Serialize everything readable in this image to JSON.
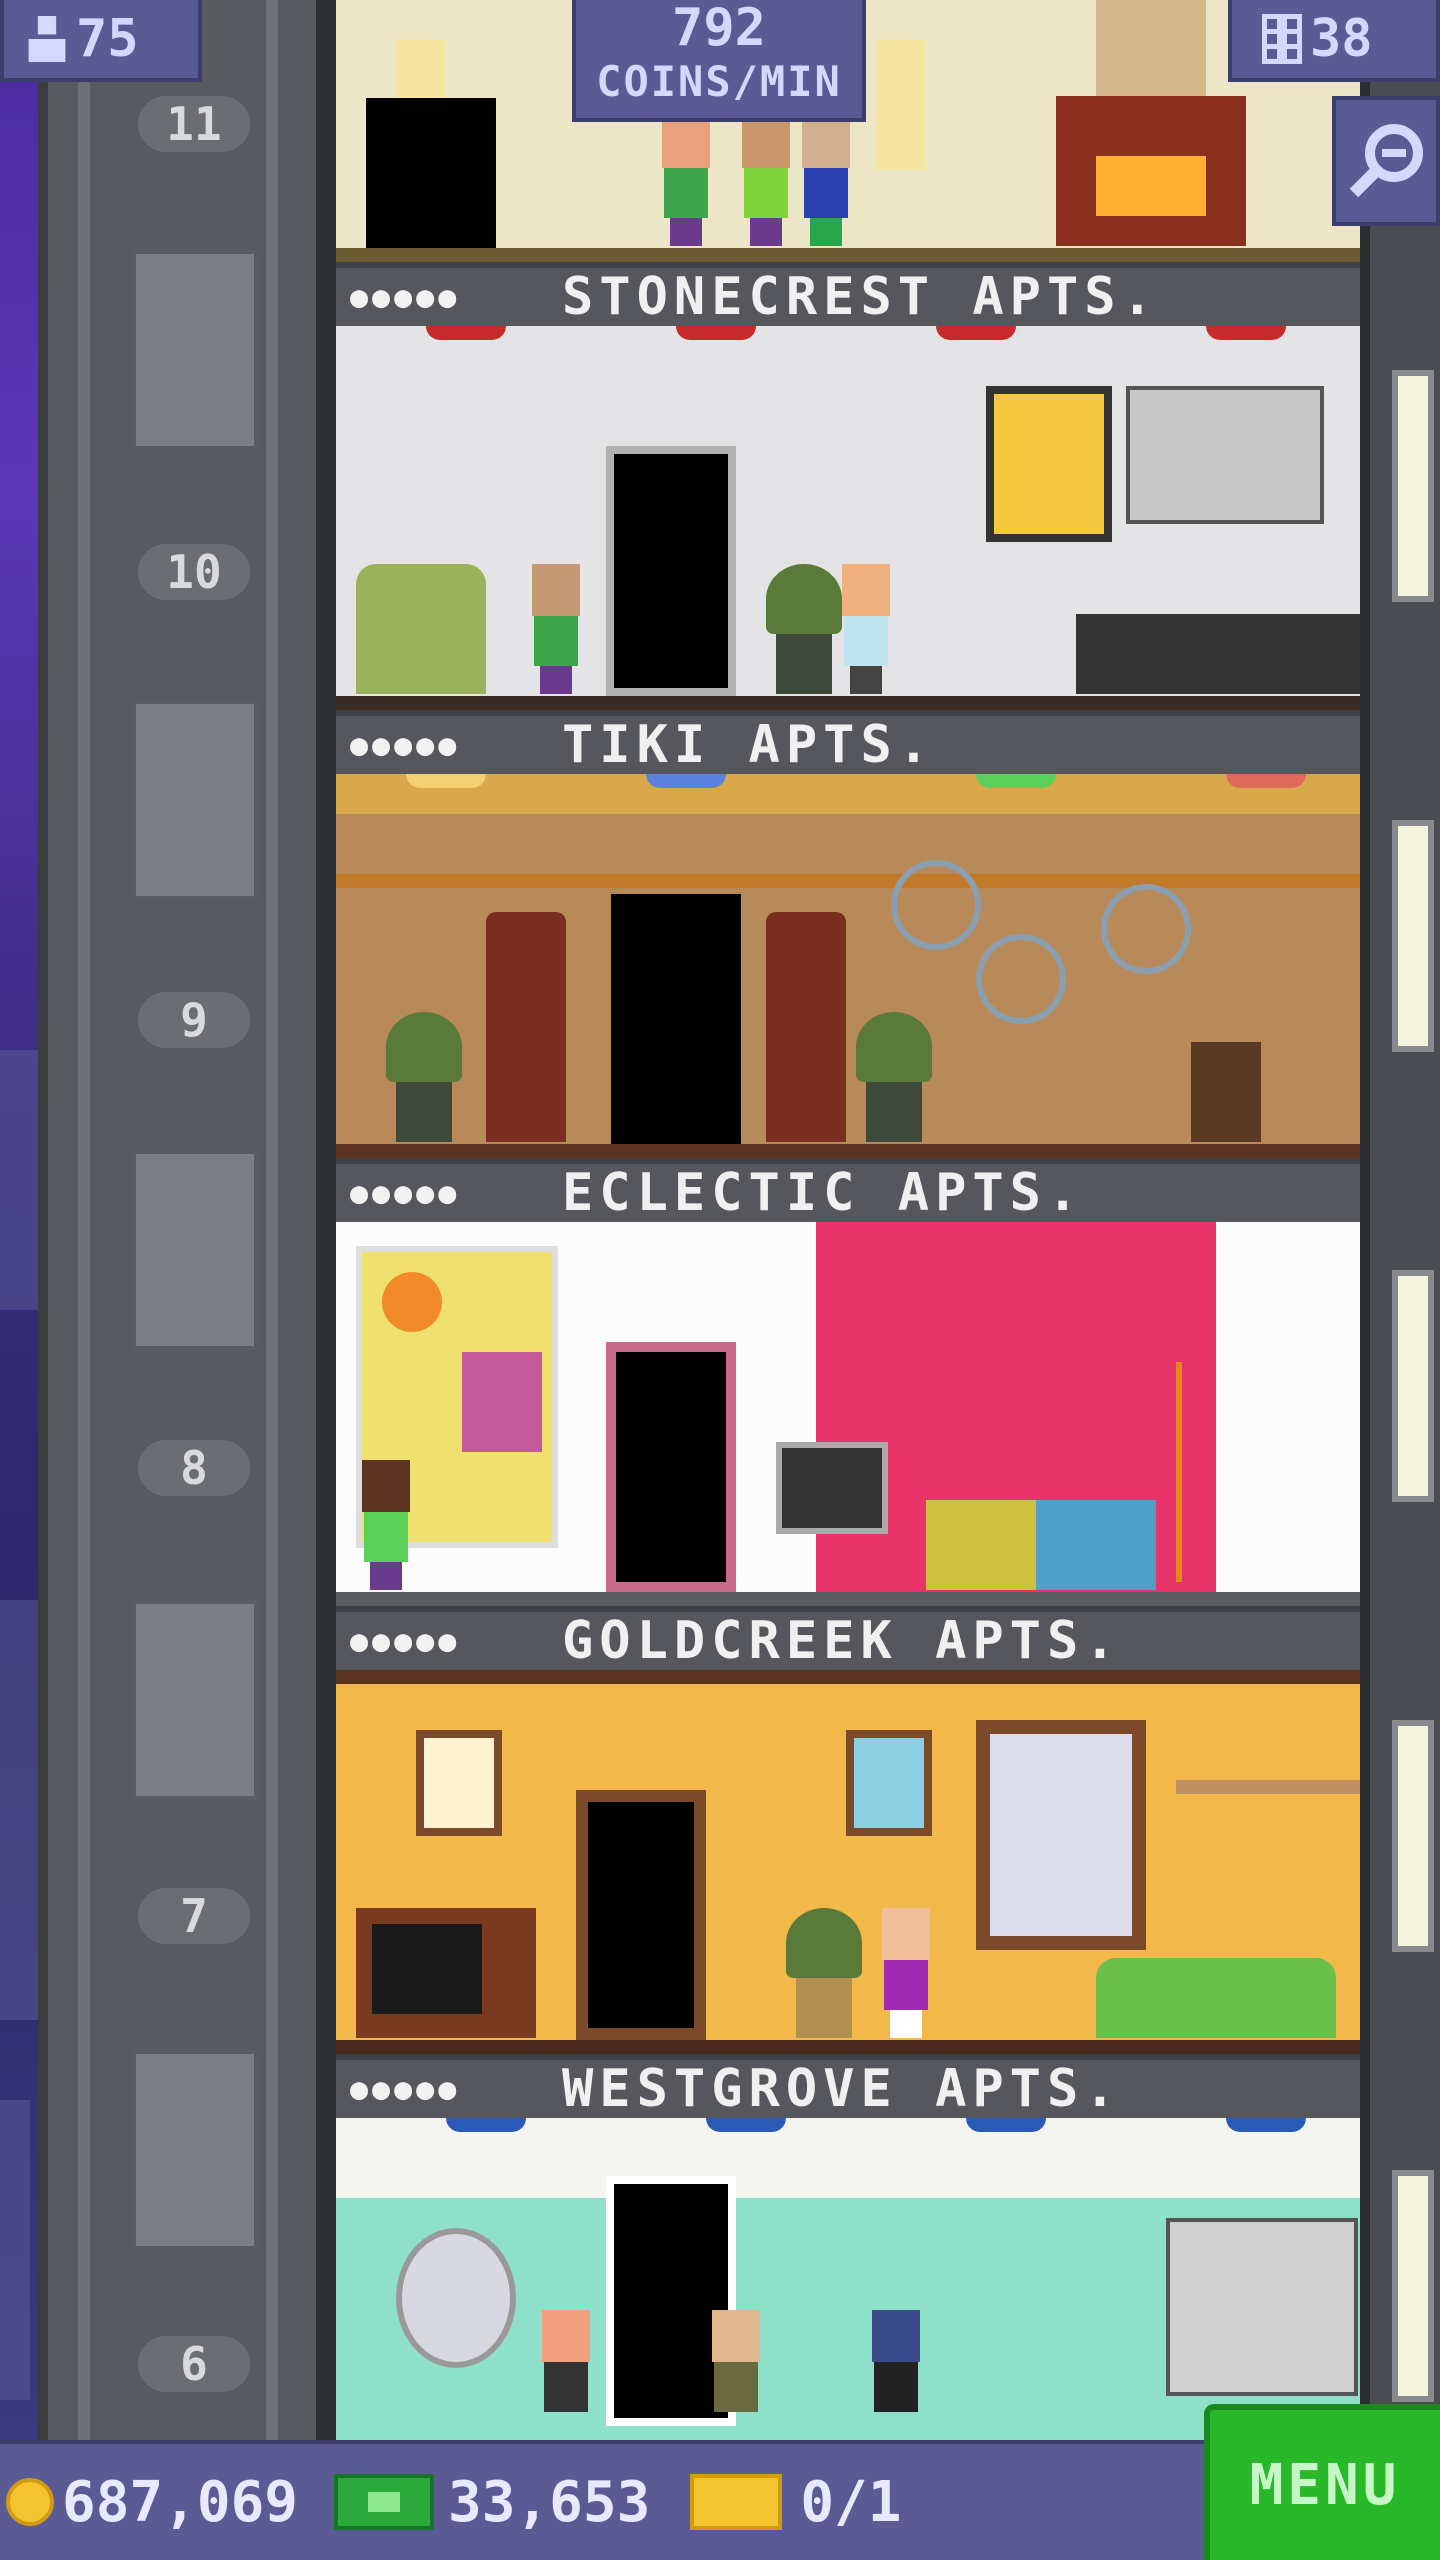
{
  "hud": {
    "population": "75",
    "coins_per_min_value": "792",
    "coins_per_min_label": "COINS/MIN",
    "floor_count": "38"
  },
  "elevator": {
    "floor_numbers": [
      "11",
      "10",
      "9",
      "8",
      "7",
      "6"
    ]
  },
  "floors": [
    {
      "name": "STONECREST APTS.",
      "stars": "●●●●●",
      "theme": "#e9e4cc"
    },
    {
      "name": "TIKI APTS.",
      "stars": "●●●●●",
      "theme": "#e6e6e6"
    },
    {
      "name": "ECLECTIC APTS.",
      "stars": "●●●●●",
      "theme": "#c9915a"
    },
    {
      "name": "GOLDCREEK APTS.",
      "stars": "●●●●●",
      "theme": "#ffffff"
    },
    {
      "name": "WESTGROVE APTS.",
      "stars": "●●●●●",
      "theme": "#f0b848"
    }
  ],
  "bottom_bar": {
    "coins": "687,069",
    "tower_bux": "33,653",
    "tickets": "0/1",
    "menu_label": "MENU"
  },
  "colors": {
    "hud_bg": "#5a5a95",
    "menu_green": "#28b82a",
    "shaft_gray": "#585a60"
  },
  "icons": [
    "person-icon",
    "building-icon",
    "magnifier-icon",
    "coin-icon",
    "bux-icon",
    "ticket-icon"
  ]
}
